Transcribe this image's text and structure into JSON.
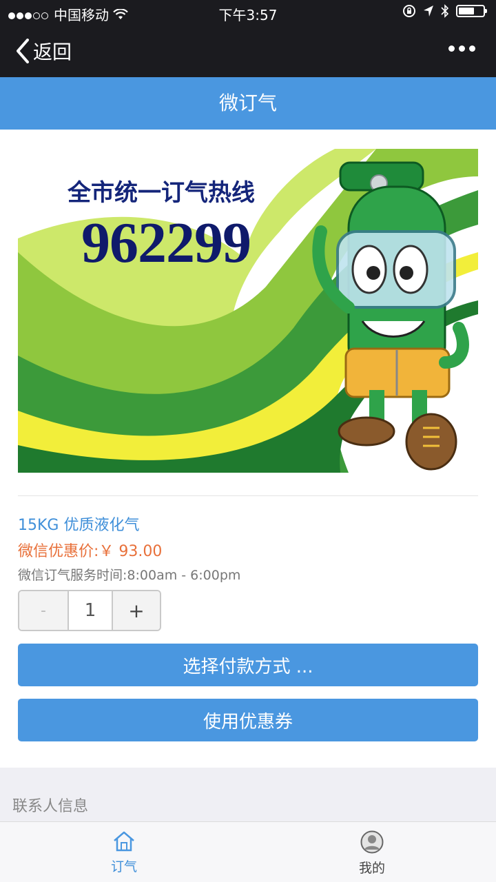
{
  "status_bar": {
    "carrier": "中国移动",
    "time": "下午3:57"
  },
  "nav": {
    "back_label": "返回"
  },
  "header": {
    "title": "微订气"
  },
  "banner": {
    "title": "全市统一订气热线",
    "number": "962299"
  },
  "product": {
    "name": "15KG 优质液化气",
    "price_label": "微信优惠价:￥ 93.00",
    "service_hours": "微信订气服务时间:8:00am - 6:00pm"
  },
  "quantity": {
    "minus": "-",
    "value": "1",
    "plus": "+"
  },
  "buttons": {
    "pay": "选择付款方式 ...",
    "coupon": "使用优惠券"
  },
  "contact_section": {
    "label": "联系人信息"
  },
  "tab_bar": {
    "tabs": [
      {
        "label": "订气",
        "icon": "home-icon",
        "active": true
      },
      {
        "label": "我的",
        "icon": "user-icon",
        "active": false
      }
    ]
  },
  "colors": {
    "accent": "#4a97e0",
    "price": "#e8703a",
    "dark_bar": "#1b1b1f"
  }
}
